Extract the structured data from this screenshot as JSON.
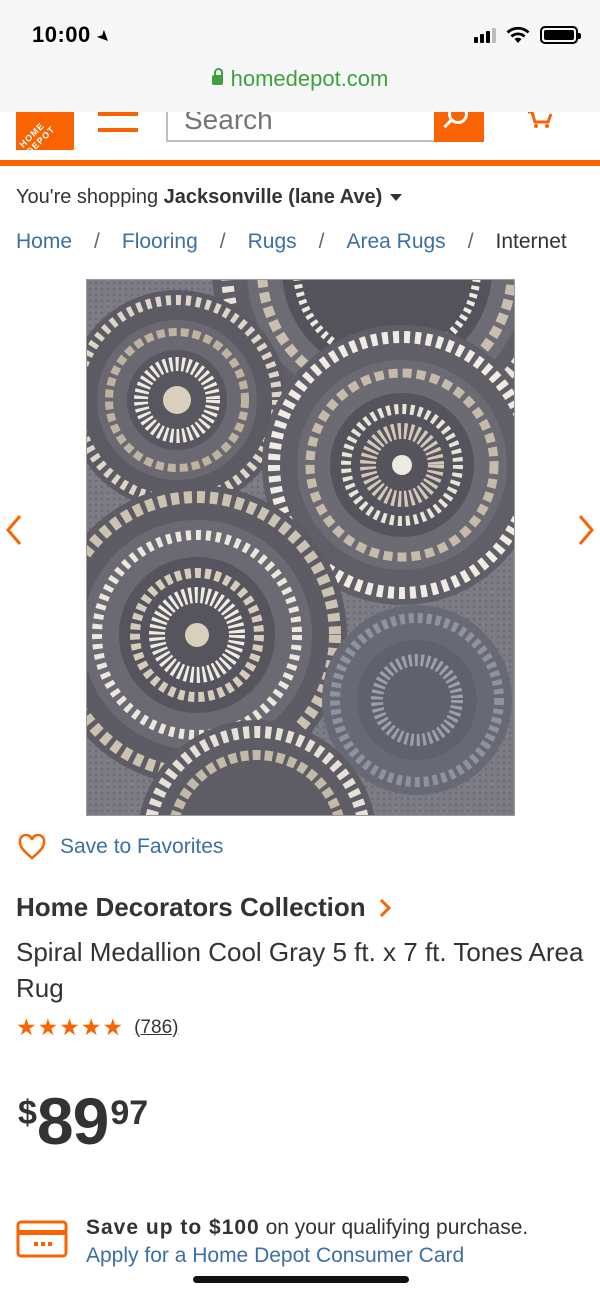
{
  "status_bar": {
    "time": "10:00",
    "location_icon": "location-arrow-icon",
    "signal_icon": "cellular-signal-icon",
    "wifi_icon": "wifi-icon",
    "battery_icon": "battery-icon"
  },
  "browser": {
    "url": "homedepot.com",
    "lock_icon": "lock-icon"
  },
  "header": {
    "logo_text": "HOME DEPOT",
    "menu_icon": "hamburger-menu-icon",
    "search_placeholder": "Search",
    "search_icon": "search-icon",
    "cart_icon": "cart-icon",
    "brand_color": "#f96302"
  },
  "store": {
    "prefix": "You're shopping",
    "name": "Jacksonville (lane Ave)"
  },
  "breadcrumb": [
    "Home",
    "Flooring",
    "Rugs",
    "Area Rugs",
    "Internet"
  ],
  "gallery": {
    "prev_icon": "chevron-left-icon",
    "next_icon": "chevron-right-icon"
  },
  "favorites": {
    "icon": "heart-icon",
    "label": "Save to Favorites"
  },
  "product": {
    "brand": "Home Decorators Collection",
    "title": "Spiral Medallion Cool Gray 5 ft. x 7 ft. Tones Area Rug",
    "rating": 5,
    "stars_text": "★★★★★",
    "review_count": "(786)",
    "price": {
      "currency": "$",
      "dollars": "89",
      "cents": "97"
    }
  },
  "promo": {
    "icon": "credit-card-icon",
    "bold_text": "Save up to $100",
    "rest_text": " on your qualifying purchase.",
    "link_text": "Apply for a Home Depot Consumer Card"
  }
}
